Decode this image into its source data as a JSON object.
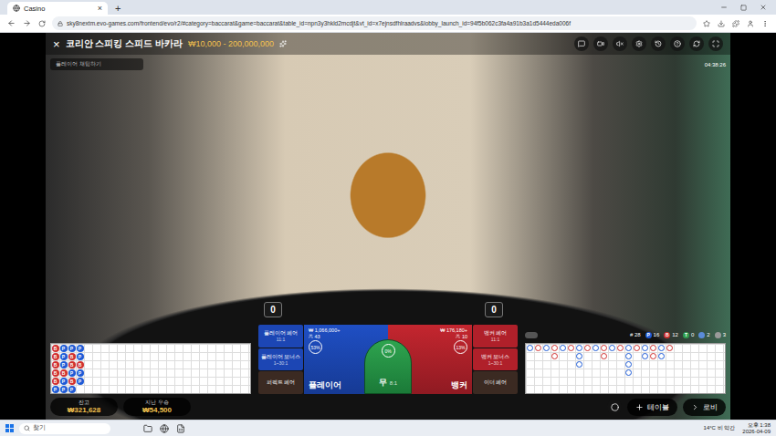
{
  "browser": {
    "tab_title": "Casino",
    "tab_close": "×",
    "new_tab": "+",
    "url": "sky8nextm.evo-games.com/frontend/evo/r2/#category=baccarat&game=baccarat&table_id=npn3y3hkld2mcdjt&vt_id=x7ejnsdfhlraadvs&lobby_launch_id=94f5b062c3fa4a91b3a1d5444eda006f"
  },
  "game": {
    "close": "×",
    "title": "코리안 스피킹 스피드 바카라",
    "limits": "₩10,000 - 200,000,000",
    "chat_placeholder": "플레이어 채팅하기",
    "timer": "04:38:26",
    "player_score": "0",
    "banker_score": "0"
  },
  "side_bets_left": [
    {
      "label": "플레이어 페어",
      "odds": "11:1",
      "kind": "player"
    },
    {
      "label": "플레이어 보너스",
      "odds": "1~30:1",
      "kind": "player"
    },
    {
      "label": "퍼펙트 페어",
      "odds": "",
      "kind": "neutral"
    }
  ],
  "side_bets_right": [
    {
      "label": "뱅커 페어",
      "odds": "11:1",
      "kind": "banker"
    },
    {
      "label": "뱅커 보너스",
      "odds": "1~30:1",
      "kind": "banker"
    },
    {
      "label": "이더 페어",
      "odds": "",
      "kind": "neutral"
    }
  ],
  "main_bets": {
    "player": {
      "label": "플레이어",
      "amount": "₩ 1,066,000+",
      "players": "43",
      "percent": "53%"
    },
    "tie": {
      "label": "무",
      "odds": "8:1",
      "percent": "0%"
    },
    "banker": {
      "label": "뱅커",
      "amount": "₩ 176,180+",
      "players": "10",
      "percent": "13%"
    }
  },
  "stats": {
    "total": "# 28",
    "items": [
      {
        "label": "P",
        "value": "16",
        "color": "#1e5bd6"
      },
      {
        "label": "B",
        "value": "12",
        "color": "#d0302f"
      },
      {
        "label": "T",
        "value": "0",
        "color": "#2e9e4f"
      },
      {
        "label": "",
        "value": "2",
        "color": "#5a8bd8"
      },
      {
        "label": "",
        "value": "3",
        "color": "#9a9a9a"
      }
    ]
  },
  "bead_road": [
    {
      "result": "B",
      "color": "#d0302f"
    },
    {
      "result": "B",
      "color": "#d0302f"
    },
    {
      "result": "B",
      "color": "#d0302f"
    },
    {
      "result": "B",
      "color": "#d0302f"
    },
    {
      "result": "B",
      "color": "#d0302f"
    },
    {
      "result": "P",
      "color": "#1e5bd6"
    },
    {
      "result": "P",
      "color": "#1e5bd6"
    },
    {
      "result": "P",
      "color": "#1e5bd6"
    },
    {
      "result": "P",
      "color": "#1e5bd6"
    },
    {
      "result": "B",
      "color": "#d0302f"
    },
    {
      "result": "P",
      "color": "#1e5bd6"
    },
    {
      "result": "P",
      "color": "#1e5bd6"
    },
    {
      "result": "P",
      "color": "#1e5bd6"
    },
    {
      "result": "B",
      "color": "#d0302f"
    },
    {
      "result": "B",
      "color": "#d0302f"
    },
    {
      "result": "P",
      "color": "#1e5bd6"
    },
    {
      "result": "B",
      "color": "#d0302f"
    },
    {
      "result": "P",
      "color": "#1e5bd6"
    },
    {
      "result": "P",
      "color": "#1e5bd6"
    },
    {
      "result": "P",
      "color": "#1e5bd6"
    },
    {
      "result": "B",
      "color": "#d0302f"
    },
    {
      "result": "P",
      "color": "#1e5bd6"
    },
    {
      "result": "P",
      "color": "#1e5bd6"
    }
  ],
  "big_road": [
    {
      "count": 1,
      "color": "#1e5bd6"
    },
    {
      "count": 1,
      "color": "#d0302f"
    },
    {
      "count": 1,
      "color": "#1e5bd6"
    },
    {
      "count": 2,
      "color": "#d0302f"
    },
    {
      "count": 1,
      "color": "#1e5bd6"
    },
    {
      "count": 1,
      "color": "#d0302f"
    },
    {
      "count": 3,
      "color": "#1e5bd6"
    },
    {
      "count": 1,
      "color": "#d0302f"
    },
    {
      "count": 1,
      "color": "#1e5bd6"
    },
    {
      "count": 2,
      "color": "#d0302f"
    },
    {
      "count": 1,
      "color": "#1e5bd6"
    },
    {
      "count": 1,
      "color": "#d0302f"
    },
    {
      "count": 4,
      "color": "#1e5bd6"
    },
    {
      "count": 1,
      "color": "#d0302f"
    },
    {
      "count": 2,
      "color": "#1e5bd6"
    },
    {
      "count": 2,
      "color": "#d0302f"
    },
    {
      "count": 2,
      "color": "#1e5bd6"
    },
    {
      "count": 1,
      "color": "#d0302f"
    }
  ],
  "footer": {
    "balance_label": "잔고",
    "balance": "₩321,628",
    "last_win_label": "지난 우승",
    "last_win": "₩54,500",
    "table_button": "테이블",
    "lobby_button": "로비"
  },
  "taskbar": {
    "search": "찾기",
    "weather": "14°C 비 약간",
    "time": "오후 1:38",
    "date": "2026-04-09"
  }
}
